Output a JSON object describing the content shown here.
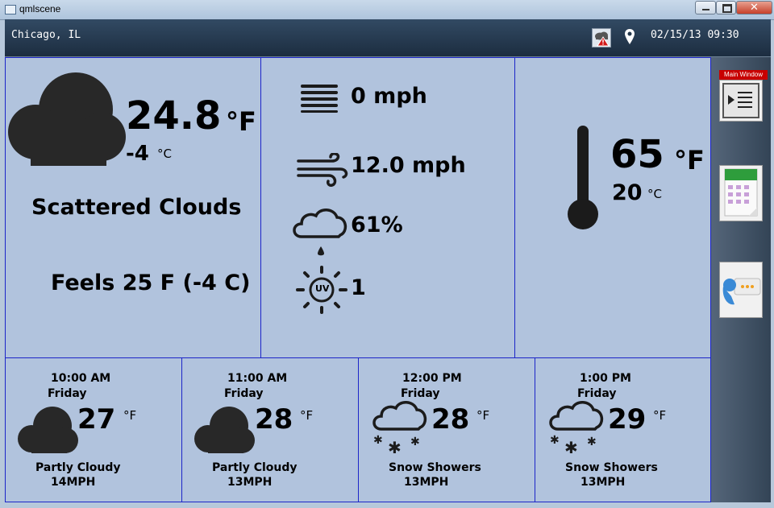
{
  "window": {
    "title": "qmlscene",
    "close_glyph": "✕"
  },
  "header": {
    "location": "Chicago, IL",
    "datetime": "02/15/13 09:30",
    "icons": [
      "weather-alert-icon",
      "location-pin-icon"
    ]
  },
  "current": {
    "icon": "cloud-icon",
    "temp_f": "24.8",
    "unit_f": "°F",
    "temp_c": "-4",
    "unit_c": "°C",
    "condition": "Scattered Clouds",
    "feels_like": "Feels 25 F (-4 C)"
  },
  "details": {
    "fog": {
      "icon": "fog-lines-icon",
      "value": "0 mph"
    },
    "wind": {
      "icon": "wind-icon",
      "value": "12.0 mph"
    },
    "humidity": {
      "icon": "rain-cloud-icon",
      "value": "61%"
    },
    "uv": {
      "icon": "uv-sun-icon",
      "badge": "UV",
      "value": "1"
    }
  },
  "thermometer": {
    "icon": "thermometer-icon",
    "temp_f": "65",
    "unit_f": "°F",
    "temp_c": "20",
    "unit_c": "°C"
  },
  "forecast": [
    {
      "time": "10:00 AM",
      "day": "Friday",
      "temp": "27",
      "unit": "°F",
      "icon": "cloud-icon",
      "condition": "Partly Cloudy",
      "wind": "14MPH"
    },
    {
      "time": "11:00 AM",
      "day": "Friday",
      "temp": "28",
      "unit": "°F",
      "icon": "cloud-icon",
      "condition": "Partly Cloudy",
      "wind": "13MPH"
    },
    {
      "time": "12:00 PM",
      "day": "Friday",
      "temp": "28",
      "unit": "°F",
      "icon": "snow-cloud-icon",
      "condition": "Snow Showers",
      "wind": "13MPH"
    },
    {
      "time": "1:00 PM",
      "day": "Friday",
      "temp": "29",
      "unit": "°F",
      "icon": "snow-cloud-icon",
      "condition": "Snow Showers",
      "wind": "13MPH"
    }
  ],
  "sidebar": {
    "main_window_label": "Main Window",
    "buttons": [
      "main-window-list-icon",
      "calendar-icon",
      "chat-icon"
    ]
  }
}
